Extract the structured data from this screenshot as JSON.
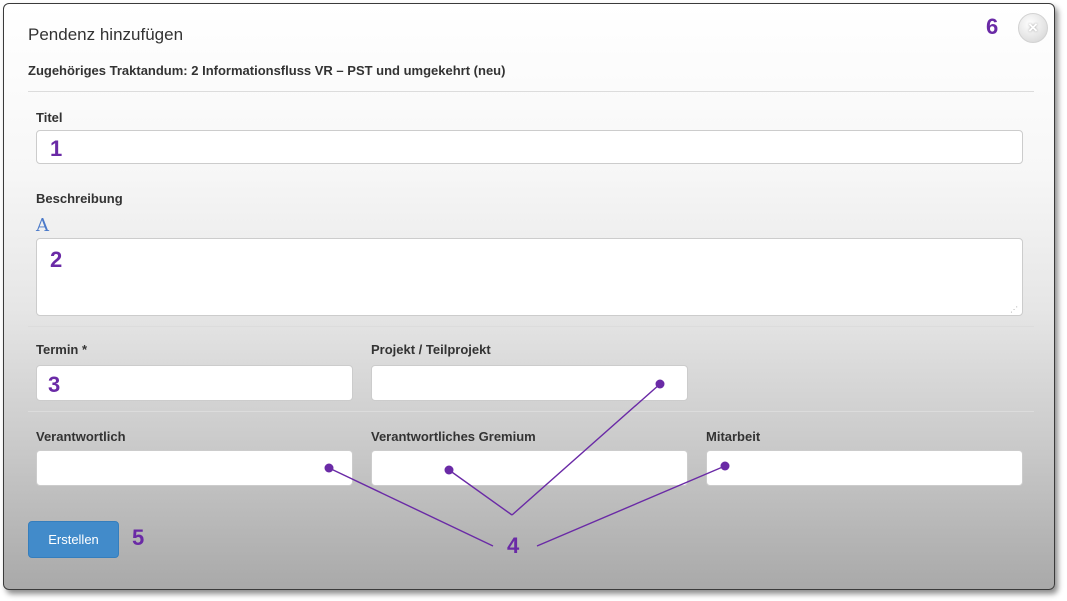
{
  "dialog": {
    "title": "Pendenz hinzufügen",
    "subtitle": "Zugehöriges Traktandum: 2 Informationsfluss VR – PST und umgekehrt (neu)",
    "close_icon": "close-icon"
  },
  "form": {
    "titel_label": "Titel",
    "beschreibung_label": "Beschreibung",
    "editor_toggle_glyph": "A",
    "termin_label": "Termin *",
    "projekt_label": "Projekt / Teilprojekt",
    "verantwortlich_label": "Verantwortlich",
    "gremium_label": "Verantwortliches Gremium",
    "mitarbeit_label": "Mitarbeit",
    "titel_value": "",
    "beschreibung_value": "",
    "termin_value": "",
    "projekt_value": "",
    "verantwortlich_value": "",
    "gremium_value": "",
    "mitarbeit_value": ""
  },
  "actions": {
    "create_label": "Erstellen"
  },
  "annotations": {
    "m1": "1",
    "m2": "2",
    "m3": "3",
    "m4": "4",
    "m5": "5",
    "m6": "6",
    "color": "#6a2aa6"
  },
  "colors": {
    "primary_button": "#428bca",
    "annotation": "#6a2aa6"
  }
}
